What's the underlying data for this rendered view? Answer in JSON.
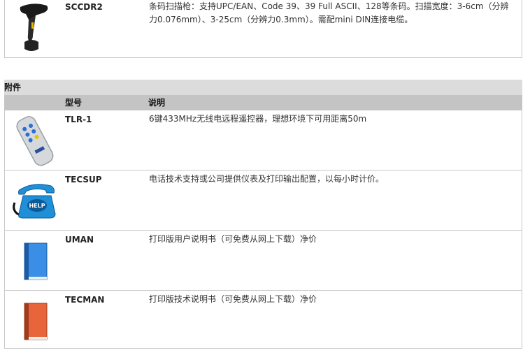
{
  "top_product": {
    "model": "SCCDR2",
    "description": "条码扫描枪：支持UPC/EAN、Code 39、39 Full ASCII、128等条码。扫描宽度：3-6cm（分辨力0.076mm）、3-25cm（分辨力0.3mm）。需配mini DIN连接电缆。"
  },
  "accessories": {
    "section_title": "附件",
    "header_model": "型号",
    "header_desc": "说明",
    "items": [
      {
        "model": "TLR-1",
        "description": "6键433MHz无线电远程遥控器，理想环境下可用距离50m",
        "icon": "remote-control-icon"
      },
      {
        "model": "TECSUP",
        "description": "电话技术支持或公司提供仪表及打印输出配置，以每小时计价。",
        "icon": "help-telephone-icon"
      },
      {
        "model": "UMAN",
        "description": "打印版用户说明书（可免费从网上下载）净价",
        "icon": "blue-book-icon"
      },
      {
        "model": "TECMAN",
        "description": "打印版技术说明书（可免费从网上下载）净价",
        "icon": "orange-book-icon"
      }
    ]
  },
  "colors": {
    "header_bg": "#c4c4c4",
    "section_bg": "#dcdcdc",
    "book_blue": "#3a8ee6",
    "book_orange": "#e8643a",
    "phone_blue": "#1f8fd8"
  }
}
